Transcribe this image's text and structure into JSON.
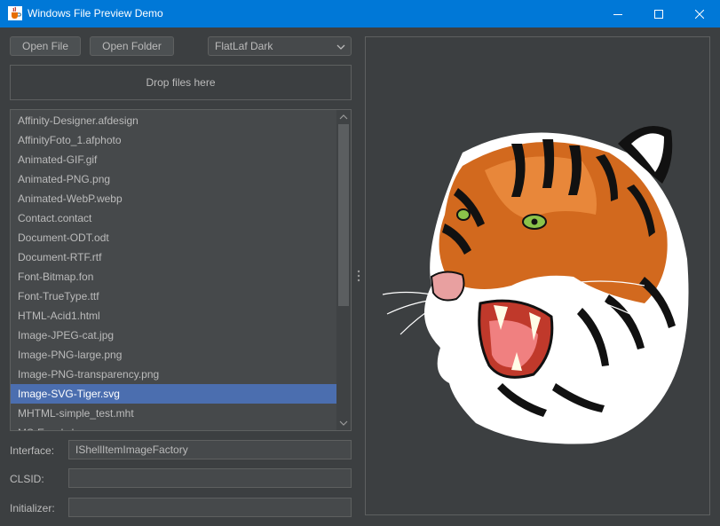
{
  "window": {
    "title": "Windows File Preview Demo",
    "app_icon": "java-cup-icon"
  },
  "toolbar": {
    "open_file_label": "Open File",
    "open_folder_label": "Open Folder",
    "theme_value": "FlatLaf Dark"
  },
  "drop_zone": {
    "label": "Drop files here"
  },
  "file_list": {
    "items": [
      "Affinity-Designer.afdesign",
      "AffinityFoto_1.afphoto",
      "Animated-GIF.gif",
      "Animated-PNG.png",
      "Animated-WebP.webp",
      "Contact.contact",
      "Document-ODT.odt",
      "Document-RTF.rtf",
      "Font-Bitmap.fon",
      "Font-TrueType.ttf",
      "HTML-Acid1.html",
      "Image-JPEG-cat.jpg",
      "Image-PNG-large.png",
      "Image-PNG-transparency.png",
      "Image-SVG-Tiger.svg",
      "MHTML-simple_test.mht",
      "MS-Excel.xlsx"
    ],
    "selected": "Image-SVG-Tiger.svg"
  },
  "details": {
    "interface_label": "Interface:",
    "interface_value": "IShellItemImageFactory",
    "clsid_label": "CLSID:",
    "clsid_value": "",
    "initializer_label": "Initializer:",
    "initializer_value": ""
  },
  "preview": {
    "image": "svg-tiger-head"
  },
  "colors": {
    "titlebar": "#0078d7",
    "background": "#3c3f41",
    "selection": "#4b6eaf",
    "text": "#bbbbbb"
  }
}
